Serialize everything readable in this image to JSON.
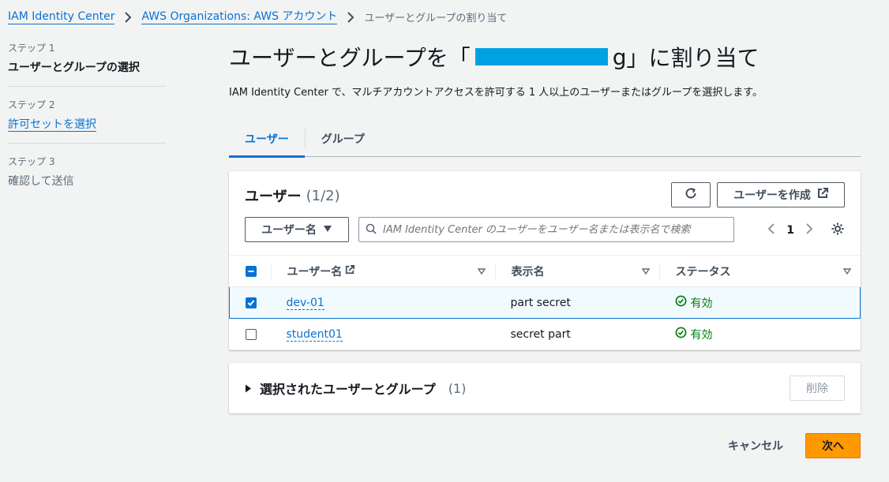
{
  "breadcrumb": {
    "items": [
      "IAM Identity Center",
      "AWS Organizations: AWS アカウント"
    ],
    "current": "ユーザーとグループの割り当て"
  },
  "steps": [
    {
      "number": "ステップ 1",
      "title": "ユーザーとグループの選択",
      "state": "active"
    },
    {
      "number": "ステップ 2",
      "title": "許可セットを選択",
      "state": "link"
    },
    {
      "number": "ステップ 3",
      "title": "確認して送信",
      "state": "disabled"
    }
  ],
  "page": {
    "title_prefix": "ユーザーとグループを「",
    "title_suffix_char": "g",
    "title_suffix": "」に割り当て",
    "description": "IAM Identity Center で、マルチアカウントアクセスを許可する 1 人以上のユーザーまたはグループを選択します。"
  },
  "tabs": [
    {
      "label": "ユーザー",
      "active": true
    },
    {
      "label": "グループ",
      "active": false
    }
  ],
  "users_panel": {
    "title": "ユーザー",
    "count": "(1/2)",
    "create_label": "ユーザーを作成",
    "filter_label": "ユーザー名",
    "search_placeholder": "IAM Identity Center のユーザーをユーザー名または表示名で検索",
    "page_number": "1",
    "columns": [
      "ユーザー名",
      "表示名",
      "ステータス"
    ],
    "rows": [
      {
        "username": "dev-01",
        "display": "part secret",
        "status": "有効",
        "selected": true
      },
      {
        "username": "student01",
        "display": "secret part",
        "status": "有効",
        "selected": false
      }
    ]
  },
  "selected_panel": {
    "title": "選択されたユーザーとグループ",
    "count": "(1)",
    "delete_label": "削除"
  },
  "footer": {
    "cancel_label": "キャンセル",
    "next_label": "次へ"
  },
  "colors": {
    "link": "#0972d3",
    "primary_button": "#ff9900",
    "status_ok": "#037f0c",
    "redaction": "#00a1e4"
  },
  "icons": {
    "breadcrumb_sep": "chevron-right-icon",
    "refresh": "refresh-icon",
    "external": "external-link-icon",
    "dropdown": "caret-down-icon",
    "search": "search-icon",
    "settings": "gear-icon",
    "status": "check-circle-icon"
  }
}
